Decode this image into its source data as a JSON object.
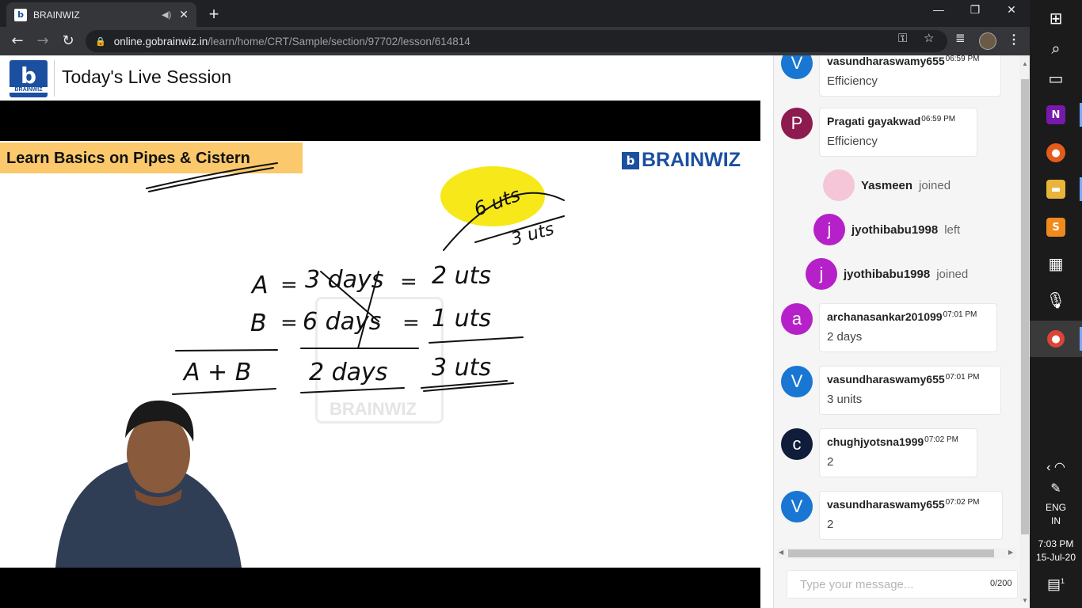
{
  "browser": {
    "tab_title": "BRAINWIZ",
    "favicon_letter": "b",
    "url_domain": "online.gobrainwiz.in",
    "url_path": "/learn/home/CRT/Sample/section/97702/lesson/614814"
  },
  "header": {
    "logo_letter": "b",
    "logo_text": "BRAINWIZ",
    "title": "Today's Live Session"
  },
  "slide": {
    "topic": "Learn Basics on Pipes & Cistern",
    "brand": "BRAINWIZ",
    "brand_letter": "b",
    "watermark": "BRAINWIZ",
    "board": {
      "cloud": "6 uts",
      "cloud_side": "3 uts",
      "row1": [
        "A",
        "=",
        "3 days",
        "=",
        "2 uts"
      ],
      "row2": [
        "B",
        "=",
        "6 days",
        "=",
        "1 uts"
      ],
      "row3": [
        "A + B",
        "2 days",
        "3 uts"
      ]
    }
  },
  "chat": {
    "messages": [
      {
        "type": "msg",
        "initial": "V",
        "color": "#1976d2",
        "sender": "vasundharaswamy655",
        "time": "06:59 PM",
        "text": "Efficiency"
      },
      {
        "type": "msg",
        "initial": "P",
        "color": "#8e1b4f",
        "sender": "Pragati gayakwad",
        "time": "06:59 PM",
        "text": "Efficiency"
      },
      {
        "type": "sys",
        "name": "Yasmeen",
        "action": "joined"
      },
      {
        "type": "sys",
        "initial": "j",
        "color": "#b620c9",
        "name": "jyothibabu1998",
        "action": "left"
      },
      {
        "type": "sys",
        "initial": "j",
        "color": "#b620c9",
        "name": "jyothibabu1998",
        "action": "joined"
      },
      {
        "type": "msg",
        "initial": "a",
        "color": "#b620c9",
        "sender": "archanasankar201099",
        "time": "07:01 PM",
        "text": "2 days"
      },
      {
        "type": "msg",
        "initial": "V",
        "color": "#1976d2",
        "sender": "vasundharaswamy655",
        "time": "07:01 PM",
        "text": "3 units"
      },
      {
        "type": "msg",
        "initial": "c",
        "color": "#0f1d3a",
        "sender": "chughjyotsna1999",
        "time": "07:02 PM",
        "text": "2"
      },
      {
        "type": "msg",
        "initial": "V",
        "color": "#1976d2",
        "sender": "vasundharaswamy655",
        "time": "07:02 PM",
        "text": "2"
      }
    ],
    "input_placeholder": "Type your message...",
    "char_count": "0/200"
  },
  "taskbar": {
    "lang": "ENG",
    "region": "IN",
    "time": "7:03 PM",
    "date": "15-Jul-20",
    "notification_count": "1"
  }
}
